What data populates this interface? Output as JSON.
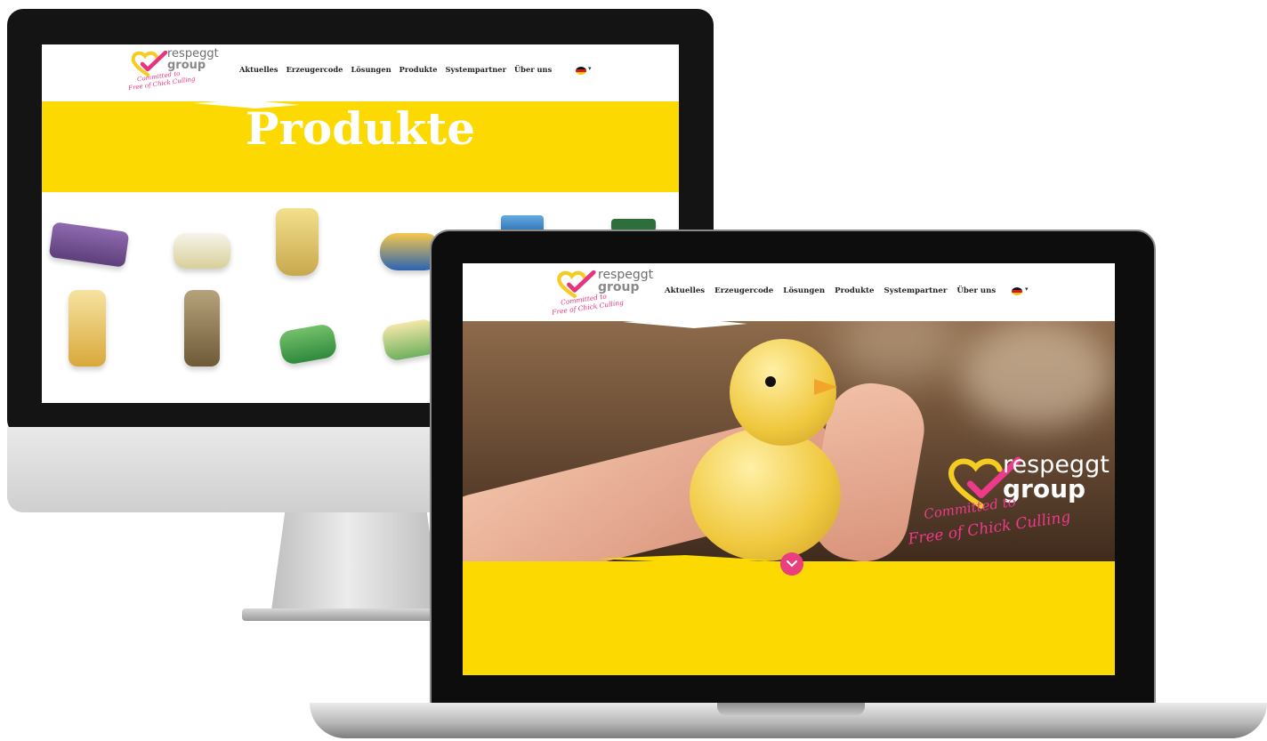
{
  "brand": {
    "name_line1": "respeggt",
    "name_line2": "group",
    "tagline_line1": "Committed to",
    "tagline_line2": "Free of Chick Culling",
    "accent_yellow": "#fcd900",
    "accent_pink": "#e6347f"
  },
  "nav": {
    "items": [
      "Aktuelles",
      "Erzeugercode",
      "Lösungen",
      "Produkte",
      "Systempartner",
      "Über uns"
    ],
    "language_flag": "flag-de-icon",
    "language_caret": "▾"
  },
  "imac_page": {
    "title": "Produkte",
    "products": [
      "egg-box-purple",
      "egg-box-clear",
      "egg-salad-cup",
      "spread-tub",
      "dessert-cup",
      "green-box",
      "pasta-bag-light",
      "pasta-bag-dark",
      "egg-box-green",
      "egg-box-printed"
    ]
  },
  "laptop_page": {
    "hero_logo_line1": "respeggt",
    "hero_logo_line2": "group",
    "hero_tagline_line1": "Committed to",
    "hero_tagline_line2": "Free of Chick Culling",
    "scroll_icon": "chevron-down-icon"
  }
}
